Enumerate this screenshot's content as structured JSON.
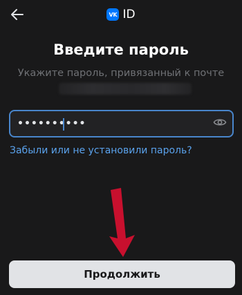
{
  "header": {
    "back_icon": "arrow-left-icon",
    "brand_logo_text": "VK",
    "brand_text": "ID"
  },
  "main": {
    "title": "Введите пароль",
    "subtitle": "Укажите пароль, привязанный к почте"
  },
  "password": {
    "value": "••••••••••",
    "eye_icon": "eye-icon"
  },
  "forgot_link": "Забыли или не установили пароль?",
  "continue_button": "Продолжить",
  "colors": {
    "background": "#19191a",
    "accent": "#4986cc",
    "link": "#5aa2ec",
    "brand": "#0077ff",
    "button_bg": "#e1e3e6",
    "annotation_arrow": "#c8102e"
  }
}
